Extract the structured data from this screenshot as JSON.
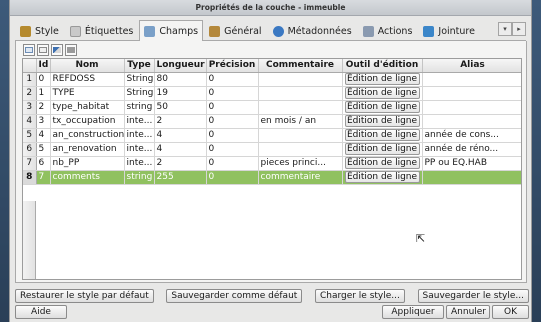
{
  "window": {
    "title": "Propriétés de la couche - immeuble"
  },
  "tabs": [
    {
      "label": "Style",
      "icon": "paintbrush-icon",
      "color": "#b58a2e"
    },
    {
      "label": "Étiquettes",
      "icon": "label-icon",
      "color": "#c9c9c9"
    },
    {
      "label": "Champs",
      "icon": "table-icon",
      "color": "#7aa0c8",
      "active": true
    },
    {
      "label": "Général",
      "icon": "tools-icon",
      "color": "#b4883b"
    },
    {
      "label": "Métadonnées",
      "icon": "info-icon",
      "color": "#3a78c2"
    },
    {
      "label": "Actions",
      "icon": "actions-icon",
      "color": "#8a9ab0"
    },
    {
      "label": "Jointure",
      "icon": "join-icon",
      "color": "#3b86c9"
    }
  ],
  "table": {
    "columns": [
      "",
      "Id",
      "Nom",
      "Type",
      "Longueur",
      "Précision",
      "Commentaire",
      "Outil d'édition",
      "Alias"
    ],
    "edit_button_label": "Édition de ligne",
    "rows": [
      {
        "num": "1",
        "id": "0",
        "nom": "REFDOSS",
        "type": "String",
        "longueur": "80",
        "precision": "0",
        "commentaire": "",
        "alias": ""
      },
      {
        "num": "2",
        "id": "1",
        "nom": "TYPE",
        "type": "String",
        "longueur": "19",
        "precision": "0",
        "commentaire": "",
        "alias": ""
      },
      {
        "num": "3",
        "id": "2",
        "nom": "type_habitat",
        "type": "string",
        "longueur": "50",
        "precision": "0",
        "commentaire": "",
        "alias": ""
      },
      {
        "num": "4",
        "id": "3",
        "nom": "tx_occupation",
        "type": "inte...",
        "longueur": "2",
        "precision": "0",
        "commentaire": "en mois / an",
        "alias": ""
      },
      {
        "num": "5",
        "id": "4",
        "nom": "an_construction",
        "type": "inte...",
        "longueur": "4",
        "precision": "0",
        "commentaire": "",
        "alias": "année de cons..."
      },
      {
        "num": "6",
        "id": "5",
        "nom": "an_renovation",
        "type": "inte...",
        "longueur": "4",
        "precision": "0",
        "commentaire": "",
        "alias": "année de réno..."
      },
      {
        "num": "7",
        "id": "6",
        "nom": "nb_PP",
        "type": "inte...",
        "longueur": "2",
        "precision": "0",
        "commentaire": "pieces princi...",
        "alias": "PP ou EQ.HAB"
      },
      {
        "num": "8",
        "id": "7",
        "nom": "comments",
        "type": "string",
        "longueur": "255",
        "precision": "0",
        "commentaire": "commentaire",
        "alias": "",
        "selected": true
      }
    ]
  },
  "buttons": {
    "restore": "Restaurer le style par défaut",
    "save_default": "Sauvegarder comme défaut",
    "load_style": "Charger le style...",
    "save_style": "Sauvegarder le style...",
    "help": "Aide",
    "apply": "Appliquer",
    "cancel": "Annuler",
    "ok": "OK"
  },
  "colors": {
    "selected_row": "#90c160"
  }
}
